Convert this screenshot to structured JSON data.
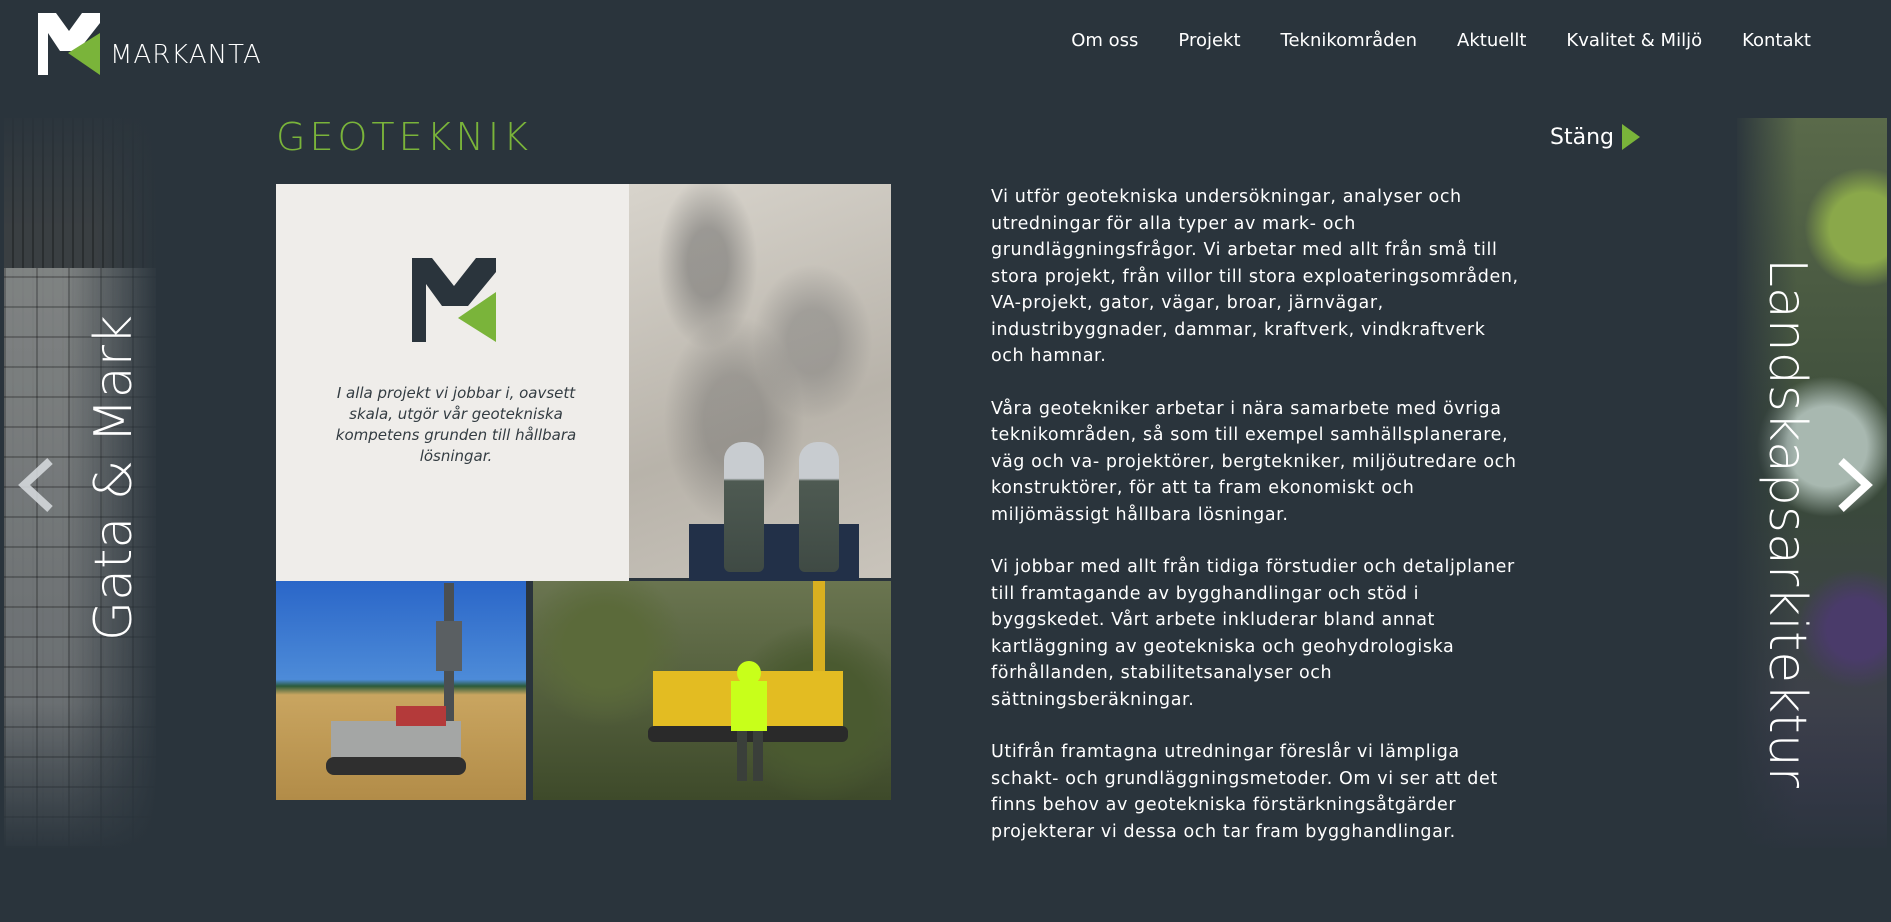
{
  "brand": {
    "name": "MARKANTA",
    "accent": "#7ab43a",
    "background": "#2a343c"
  },
  "nav": [
    {
      "label": "Om oss"
    },
    {
      "label": "Projekt"
    },
    {
      "label": "Teknikområden"
    },
    {
      "label": "Aktuellt"
    },
    {
      "label": "Kvalitet & Miljö"
    },
    {
      "label": "Kontakt"
    }
  ],
  "page": {
    "title": "GEOTEKNIK",
    "close_label": "Stäng",
    "quote": "I alla projekt vi jobbar i, oavsett skala, utgör vår geotekniska kompetens grunden till hållbara lösningar.",
    "paragraphs": [
      "Vi utför geotekniska undersökningar, analyser och utredningar för alla typer av mark- och grundläggningsfrågor. Vi arbetar med allt från små till stora projekt, från villor till stora exploateringsområden, VA-projekt, gator, vägar, broar, järnvägar, industribyggnader, dammar, kraftverk, vindkraftverk och hamnar.",
      "Våra geotekniker arbetar i nära samarbete med övriga teknikområden, så som till exempel samhällsplanerare, väg och va- projektörer, bergtekniker, miljöutredare och konstruktörer, för att ta fram ekonomiskt och miljömässigt hållbara lösningar.",
      "Vi jobbar med allt från tidiga förstudier och detaljplaner till framtagande av bygghandlingar och stöd i byggskedet. Vårt arbete inkluderar bland annat kartläggning av geotekniska och geohydrologiska förhållanden, stabilitetsanalyser och sättningsberäkningar.",
      "Utifrån framtagna utredningar föreslår vi lämpliga schakt- och grundläggningsmetoder. Om vi ser att det finns behov av geotekniska förstärkningsåtgärder projekterar vi dessa och tar fram bygghandlingar."
    ]
  },
  "carousel": {
    "prev_label": "Gata & Mark",
    "next_label": "Landskapsarkitektur"
  }
}
